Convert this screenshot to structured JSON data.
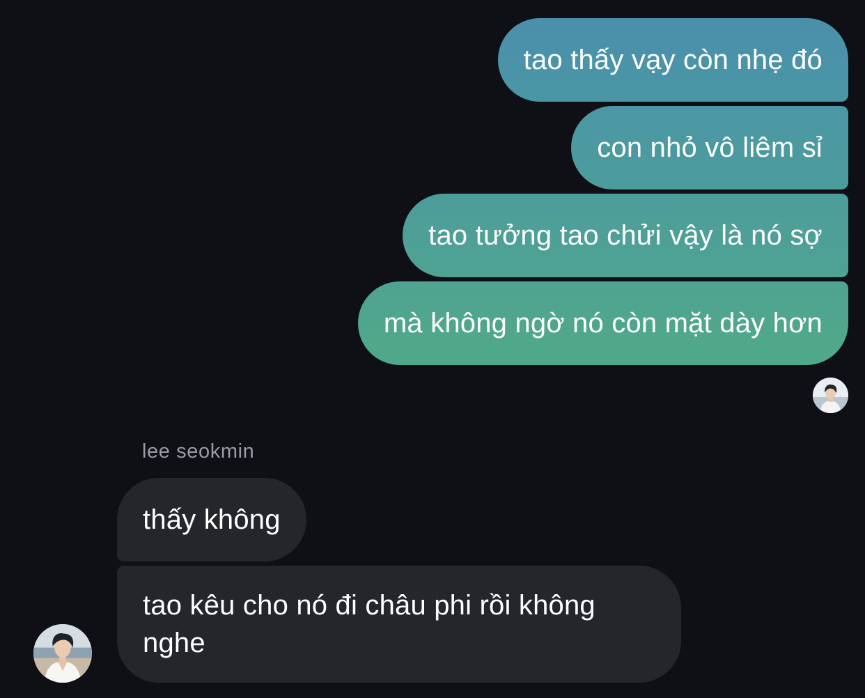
{
  "outgoing_messages": [
    "tao thấy vạy còn nhẹ đó",
    "con nhỏ vô liêm sỉ",
    "tao tưởng tao chửi vậy là nó sợ",
    "mà không ngờ nó còn mặt dày hơn"
  ],
  "incoming": {
    "sender_name": "lee seokmin",
    "messages": [
      "thấy không",
      "tao kêu cho nó đi châu phi rồi không nghe"
    ]
  },
  "colors": {
    "background": "#0e1016",
    "outgoing_gradient_top": "#4a8ead",
    "outgoing_gradient_bottom": "#50a88a",
    "incoming_bubble": "#24262b",
    "sender_name": "#9a9ca3"
  }
}
